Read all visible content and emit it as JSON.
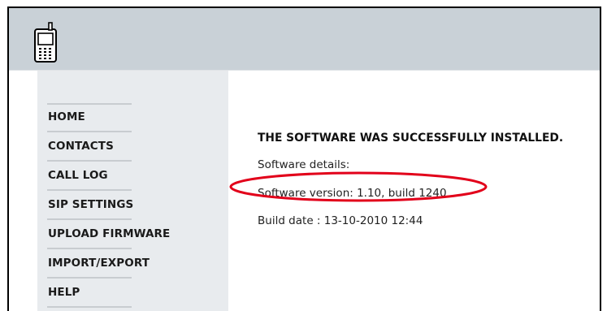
{
  "header": {
    "logo_icon": "mobile-phone-icon",
    "colors": {
      "header_bg": "#c9d1d7",
      "sidebar_bg": "#e8ebee",
      "highlight": "#e2001a"
    }
  },
  "sidebar": {
    "items": [
      {
        "label": "HOME"
      },
      {
        "label": "CONTACTS"
      },
      {
        "label": "CALL LOG"
      },
      {
        "label": "SIP SETTINGS"
      },
      {
        "label": "UPLOAD FIRMWARE"
      },
      {
        "label": "IMPORT/EXPORT"
      },
      {
        "label": "HELP"
      }
    ]
  },
  "main": {
    "success_message": "THE SOFTWARE WAS SUCCESSFULLY INSTALLED.",
    "details_label": "Software details:",
    "software_version": "Software version: 1.10, build 1240",
    "build_date": "Build date : 13-10-2010 12:44"
  }
}
